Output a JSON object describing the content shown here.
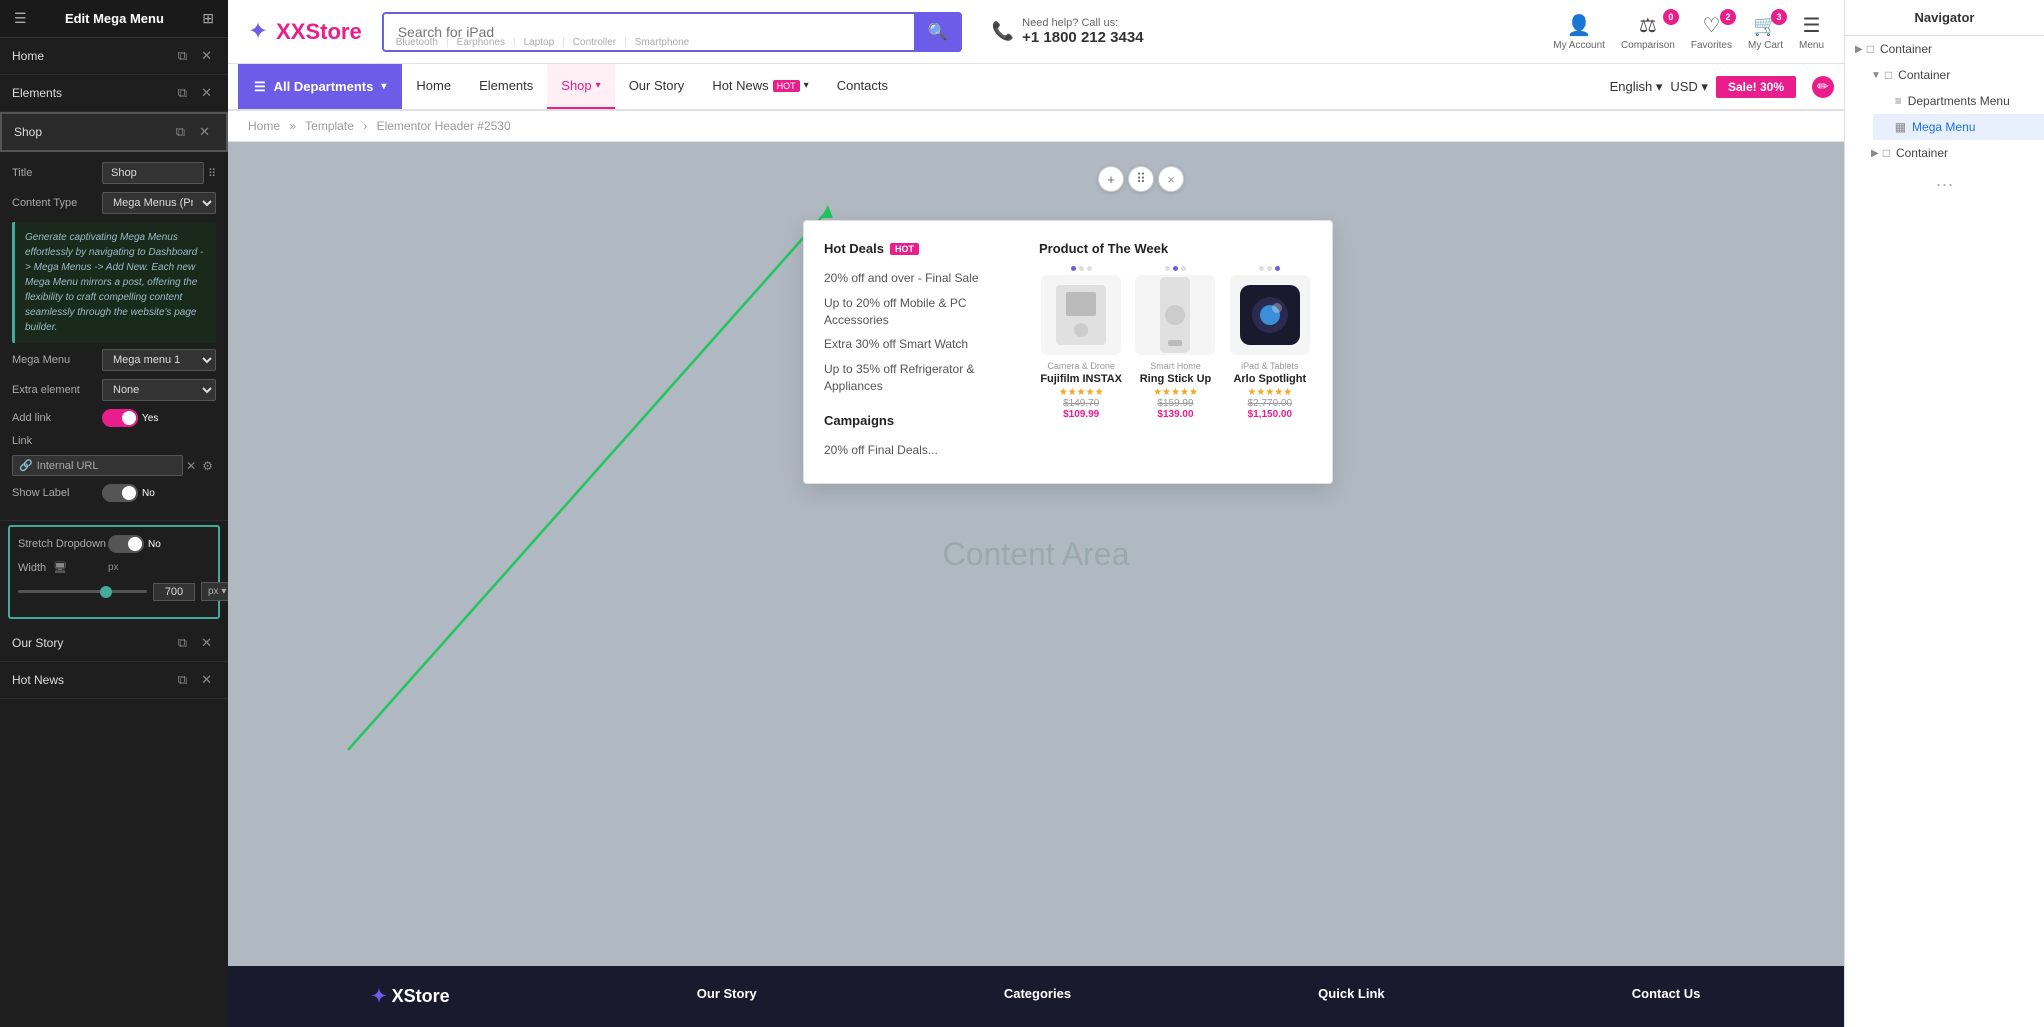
{
  "leftPanel": {
    "title": "Edit Mega Menu",
    "menuItems": [
      {
        "label": "Home"
      },
      {
        "label": "Elements"
      },
      {
        "label": "Shop"
      },
      {
        "label": "Our Story"
      },
      {
        "label": "Hot News"
      }
    ],
    "settings": {
      "titleLabel": "Title",
      "titleValue": "Shop",
      "contentTypeLabel": "Content Type",
      "contentTypeValue": "Mega Menus (Pre",
      "infoText": "Generate captivating Mega Menus effortlessly by navigating to Dashboard -> Mega Menus -> Add New. Each new Mega Menu mirrors a post, offering the flexibility to craft compelling content seamlessly through the website's page builder.",
      "megaMenuLabel": "Mega Menu",
      "megaMenuValue": "Mega menu 1",
      "extraElementLabel": "Extra element",
      "extraElementValue": "None",
      "addLinkLabel": "Add link",
      "addLinkValue": "Yes",
      "linkLabel": "Link",
      "linkType": "Internal URL",
      "showLabelLabel": "Show Label",
      "showLabelValue": "No",
      "stretchDropdownLabel": "Stretch Dropdown",
      "stretchDropdownValue": "No",
      "widthLabel": "Width",
      "widthUnit": "px",
      "widthValue": "700"
    }
  },
  "topBar": {
    "logoText": "XStore",
    "searchPlaceholder": "Search for iPad",
    "subLinks": [
      "Bluetooth",
      "Earphones",
      "Laptop",
      "Controller",
      "Smartphone"
    ],
    "helpText": "Need help? Call us:",
    "phoneNumber": "+1 1800 212 3434",
    "myAccountLabel": "My Account",
    "comparisonLabel": "Comparison",
    "comparisonCount": "0",
    "favoritesLabel": "Favorites",
    "favoritesCount": "2",
    "myCartLabel": "My Cart",
    "myCartCount": "3",
    "menuLabel": "Menu"
  },
  "navBar": {
    "allDepts": "All Departments",
    "items": [
      {
        "label": "Home",
        "active": false
      },
      {
        "label": "Elements",
        "active": false
      },
      {
        "label": "Shop",
        "active": true,
        "hasChevron": true
      },
      {
        "label": "Our Story",
        "active": false
      },
      {
        "label": "Hot News",
        "active": false,
        "hasBadge": true,
        "hasChevron": true
      },
      {
        "label": "Contacts",
        "active": false
      }
    ],
    "language": "English",
    "currency": "USD",
    "saleBadge": "Sale! 30%"
  },
  "megaMenu": {
    "col1": {
      "title": "Hot Deals",
      "hotTag": "HOT",
      "links": [
        "20% off and over - Final Sale",
        "Up to 20% off Mobile & PC Accessories",
        "Extra 30% off Smart Watch",
        "Up to 35% off Refrigerator & Appliances"
      ]
    },
    "col1b": {
      "title": "Campaigns",
      "links": [
        "20% off Final Deals..."
      ]
    },
    "col2": {
      "title": "Product of The Week",
      "products": [
        {
          "category": "Camera & Drone",
          "name": "Fujifilm INSTAX",
          "stars": "★★★★★",
          "oldPrice": "$149.70",
          "newPrice": "$109.99"
        },
        {
          "category": "Smart Home",
          "name": "Ring Stick Up",
          "stars": "★★★★★",
          "oldPrice": "$159.99",
          "newPrice": "$139.00"
        },
        {
          "category": "iPad & Tablets",
          "name": "Arlo Spotlight",
          "stars": "★★★★★",
          "oldPrice": "$2,770.00",
          "newPrice": "$1,150.00"
        }
      ]
    }
  },
  "floatToolbar": {
    "addIcon": "+",
    "moveIcon": "⠿",
    "closeIcon": "×"
  },
  "canvas": {
    "contentAreaLabel": "Content Area",
    "breadcrumb": [
      "Home",
      "Template",
      "Elementor Header #2530"
    ]
  },
  "footer": {
    "cols": [
      {
        "title": "Our Story"
      },
      {
        "title": "Categories"
      },
      {
        "title": "Quick Link"
      },
      {
        "title": "Contact Us"
      }
    ]
  },
  "rightPanel": {
    "title": "Navigator",
    "items": [
      {
        "label": "Container",
        "level": 0,
        "expanded": true
      },
      {
        "label": "Container",
        "level": 1,
        "expanded": true
      },
      {
        "label": "Departments Menu",
        "level": 2
      },
      {
        "label": "Mega Menu",
        "level": 2,
        "selected": true
      },
      {
        "label": "Container",
        "level": 1,
        "expanded": false
      }
    ]
  }
}
